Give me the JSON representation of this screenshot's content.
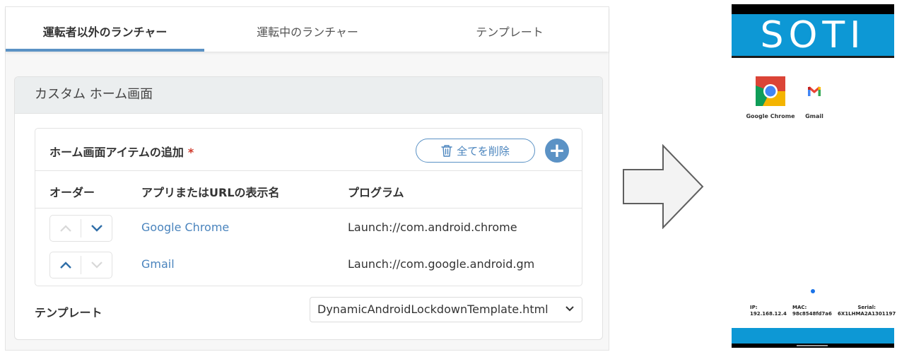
{
  "tabs": [
    {
      "label": "運転者以外のランチャー",
      "active": true
    },
    {
      "label": "運転中のランチャー",
      "active": false
    },
    {
      "label": "テンプレート",
      "active": false
    }
  ],
  "custom_home": {
    "title": "カスタム ホーム画面",
    "section_title": "ホーム画面アイテムの追加",
    "required_mark": "*",
    "delete_all_label": "全てを削除",
    "add_label": "+",
    "columns": {
      "order": "オーダー",
      "name": "アプリまたはURLの表示名",
      "program": "プログラム"
    },
    "rows": [
      {
        "name": "Google Chrome",
        "program": "Launch://com.android.chrome"
      },
      {
        "name": "Gmail",
        "program": "Launch://com.google.android.gm"
      }
    ],
    "template_label": "テンプレート",
    "template_value": "DynamicAndroidLockdownTemplate.html"
  },
  "phone": {
    "brand": "SOTI",
    "apps": [
      {
        "label": "Google Chrome",
        "icon": "chrome-icon"
      },
      {
        "label": "Gmail",
        "icon": "gmail-icon"
      }
    ],
    "ip_label": "IP:",
    "ip_value": "192.168.12.4",
    "mac_label": "MAC:",
    "mac_value": "98c8548fd7a6",
    "serial_label": "Serial:",
    "serial_value": "6X1LHMA2A1301197"
  },
  "colors": {
    "accent": "#5b92c5",
    "link": "#4a84bd",
    "soti_blue": "#0d98d5",
    "required": "#d0392b"
  }
}
